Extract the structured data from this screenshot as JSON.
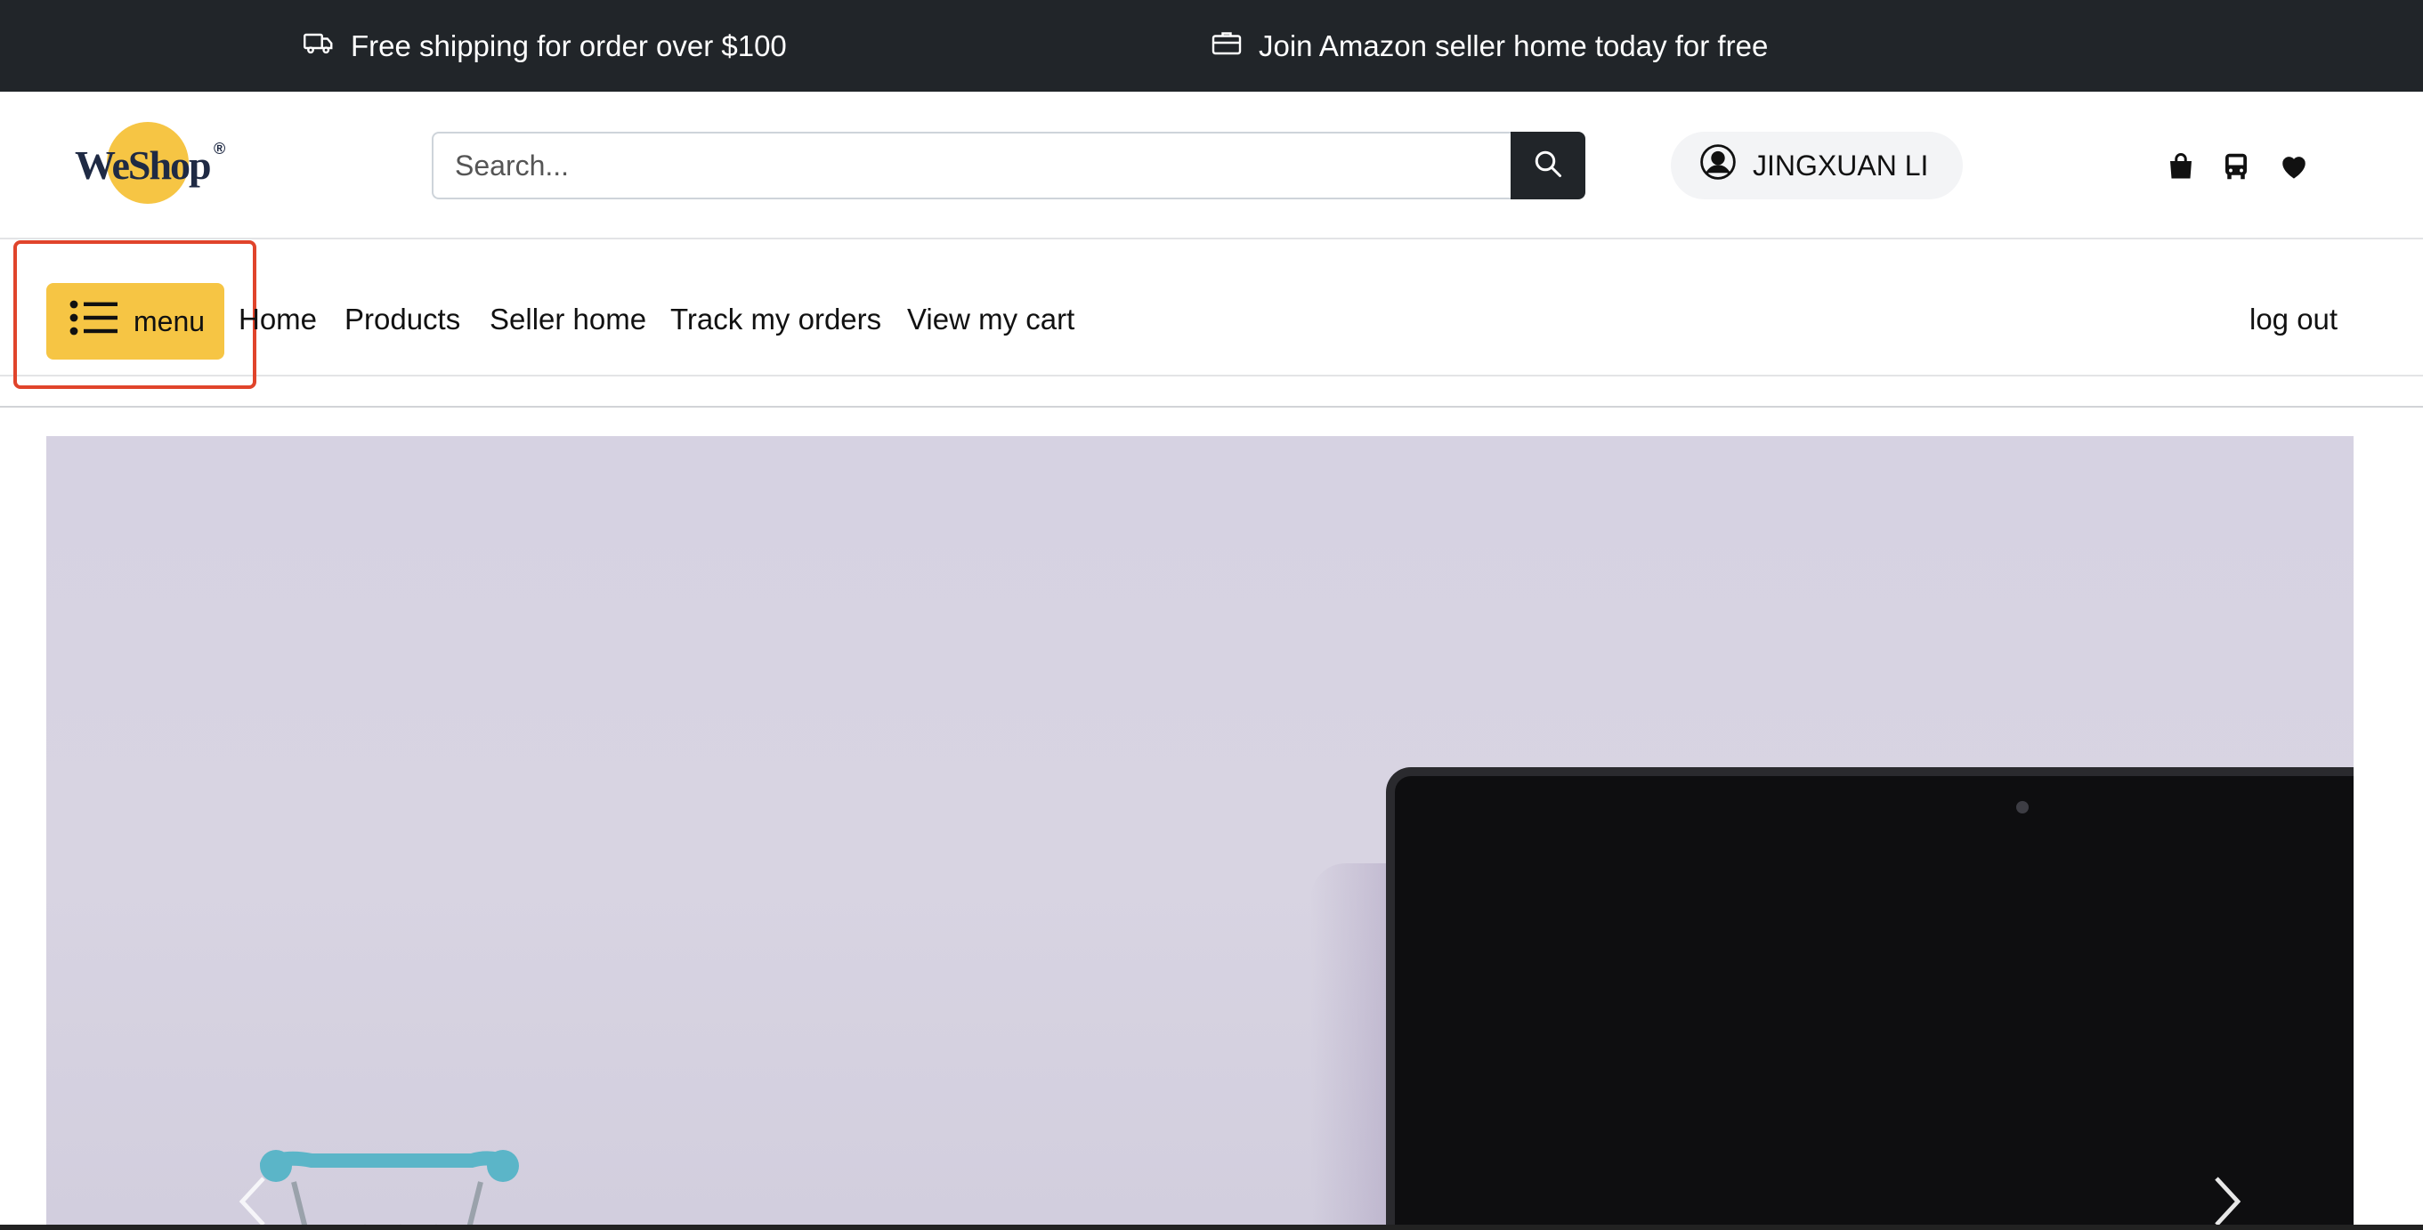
{
  "topbar": {
    "promo_shipping": "Free shipping for order over $100",
    "promo_seller": "Join Amazon seller home today for free"
  },
  "header": {
    "logo_text": "WeShop",
    "logo_sup": "®",
    "search_placeholder": "Search...",
    "user_name": "JINGXUAN LI",
    "icons": [
      "shopping-bag-icon",
      "bus-icon",
      "heart-icon"
    ]
  },
  "nav": {
    "menu_label": "menu",
    "links": [
      "Home",
      "Products",
      "Seller home",
      "Track my orders",
      "View my cart"
    ],
    "logout_label": "log out"
  },
  "colors": {
    "topbar_bg": "#212529",
    "accent_yellow": "#f6c544",
    "highlight_red": "#e0442b"
  }
}
